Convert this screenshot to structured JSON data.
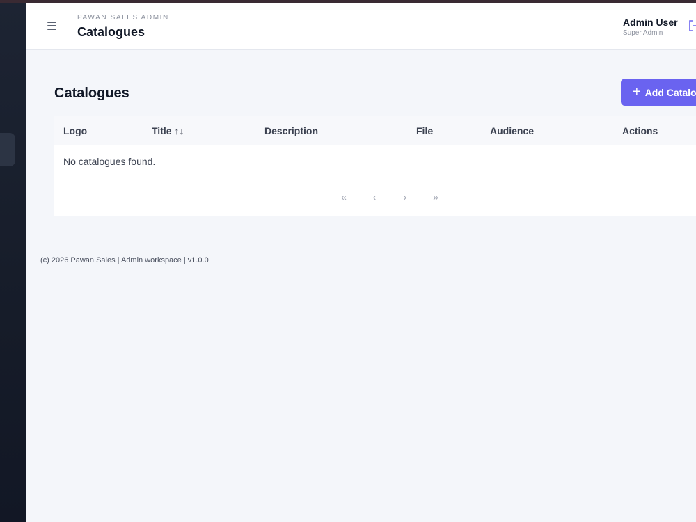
{
  "header": {
    "eyebrow": "PAWAN SALES ADMIN",
    "title": "Catalogues",
    "user_name": "Admin User",
    "user_role": "Super Admin"
  },
  "page": {
    "title": "Catalogues",
    "add_button_label": "Add Catalogue"
  },
  "table": {
    "columns": [
      "Logo",
      "Title",
      "Description",
      "File",
      "Audience",
      "Actions"
    ],
    "sort_indicator": "↑↓",
    "empty_message": "No catalogues found."
  },
  "pagination": {
    "first": "«",
    "prev": "‹",
    "next": "›",
    "last": "»"
  },
  "footer": {
    "text": "(c) 2026 Pawan Sales | Admin workspace | v1.0.0"
  },
  "colors": {
    "accent": "#6a63f0",
    "sidebar": "#1d2433",
    "background": "#f4f6fa"
  },
  "icons": {
    "menu": "hamburger-menu-icon",
    "logout": "logout-icon",
    "add": "plus-icon",
    "sort": "sort-icon"
  }
}
